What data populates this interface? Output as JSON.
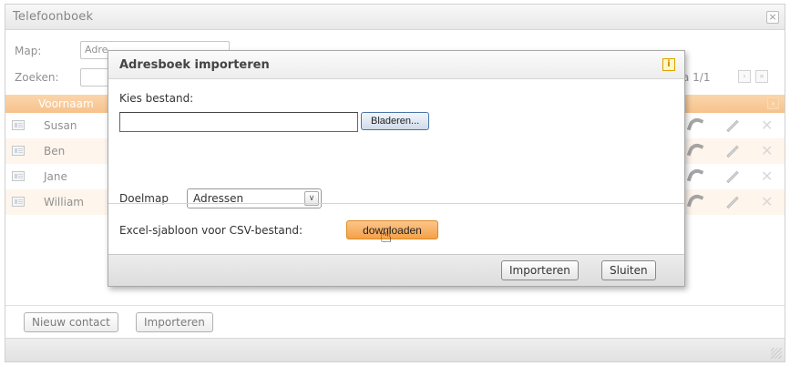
{
  "window": {
    "title": "Telefoonboek",
    "close_glyph": "×"
  },
  "filters": {
    "map_label": "Map:",
    "map_value": "Adre",
    "search_label": "Zoeken:",
    "page_info": "a 1/1",
    "next_glyph": "›",
    "last_glyph": "»"
  },
  "table": {
    "header_first": "Voornaam",
    "corner_glyph": "›",
    "rows": [
      {
        "name": "Susan"
      },
      {
        "name": "Ben"
      },
      {
        "name": "Jane"
      },
      {
        "name": "William"
      }
    ],
    "delete_glyph": "✕"
  },
  "bottom": {
    "new_contact_label": "Nieuw contact",
    "import_label": "Importeren"
  },
  "dialog": {
    "title": "Adresboek importeren",
    "info_glyph": "i",
    "choose_file_label": "Kies bestand:",
    "browse_label": "Bladeren...",
    "target_label": "Doelmap",
    "target_value": "Adressen",
    "dropdown_glyph": "∨",
    "template_label": "Excel-sjabloon voor CSV-bestand:",
    "download_label": "downloaden",
    "cursor_glyph": "☝",
    "import_button": "Importeren",
    "close_button": "Sluiten"
  },
  "colors": {
    "accent_orange": "#f2a24f",
    "row_alt": "#fdf0e2",
    "download_orange": "#f5a048"
  },
  "icons": [
    "close-icon",
    "contact-card-icon",
    "phone-icon",
    "pencil-icon",
    "delete-icon",
    "info-icon",
    "chevron-down-icon",
    "hand-cursor-icon",
    "resize-grip-icon"
  ]
}
